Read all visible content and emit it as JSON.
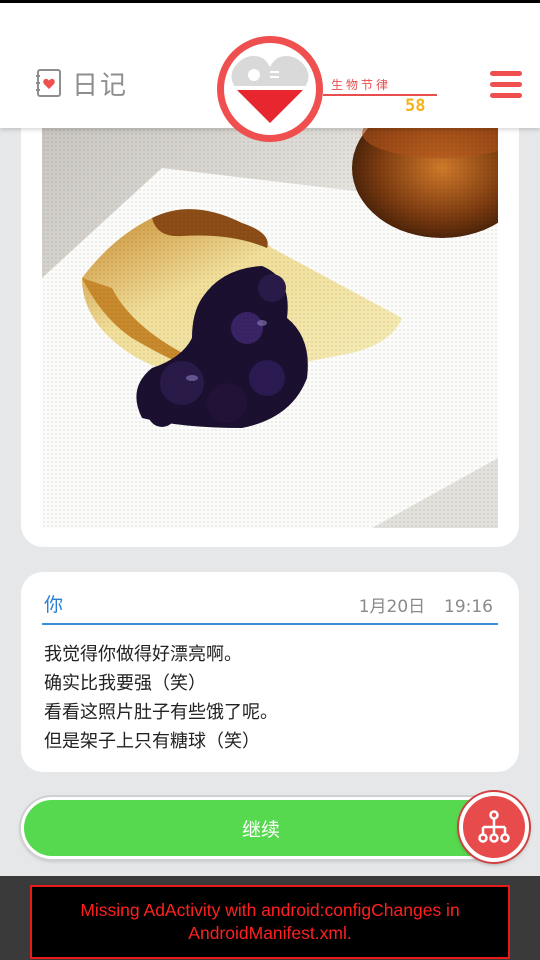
{
  "header": {
    "diary_label": "日记",
    "diary_icon": "diary-heart-icon",
    "badge_icon": "heart-half-icon",
    "biorhythm_label": "生物节律",
    "biorhythm_value": "58",
    "menu_icon": "hamburger-menu-icon",
    "accent_color": "#ef4f4f",
    "value_color": "#f5b21b"
  },
  "photo": {
    "description_icon": "cheesecake-photo"
  },
  "message": {
    "sender": "你",
    "date": "1月20日",
    "time": "19:16",
    "lines": [
      "我觉得你做得好漂亮啊。",
      "确实比我要强（笑）",
      "看看这照片肚子有些饿了呢。",
      "但是架子上只有糖球（笑）"
    ]
  },
  "actions": {
    "continue_label": "继续",
    "continue_color": "#56d94f",
    "tree_icon": "branch-tree-icon"
  },
  "ad": {
    "line1": "Missing AdActivity with android:configChanges in",
    "line2": "AndroidManifest.xml."
  }
}
